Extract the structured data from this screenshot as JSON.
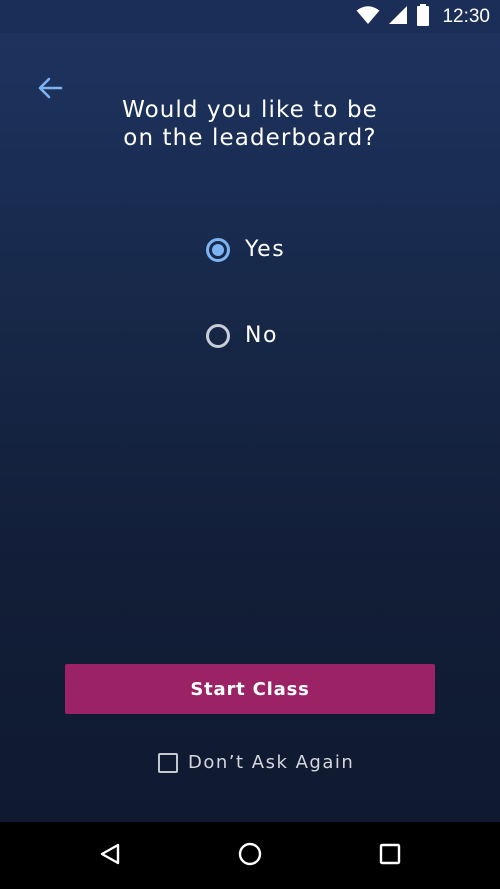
{
  "status_bar": {
    "time": "12:30",
    "icons": [
      "wifi-icon",
      "cell-signal-icon",
      "battery-icon"
    ]
  },
  "header": {
    "back_icon": "arrow-left-icon"
  },
  "prompt": {
    "line1": "Would you like to be",
    "line2": "on the leaderboard?"
  },
  "options": [
    {
      "label": "Yes",
      "selected": true
    },
    {
      "label": "No",
      "selected": false
    }
  ],
  "start_button": {
    "label": "Start Class"
  },
  "dont_ask": {
    "label": "Don’t Ask Again",
    "checked": false
  },
  "nav_bar": {
    "icons": [
      "nav-back-icon",
      "nav-home-icon",
      "nav-recents-icon"
    ]
  },
  "colors": {
    "accent": "#7eb3f2",
    "button": "#9b2265",
    "background_top": "#1d335f",
    "background_bottom": "#0f1a31"
  }
}
